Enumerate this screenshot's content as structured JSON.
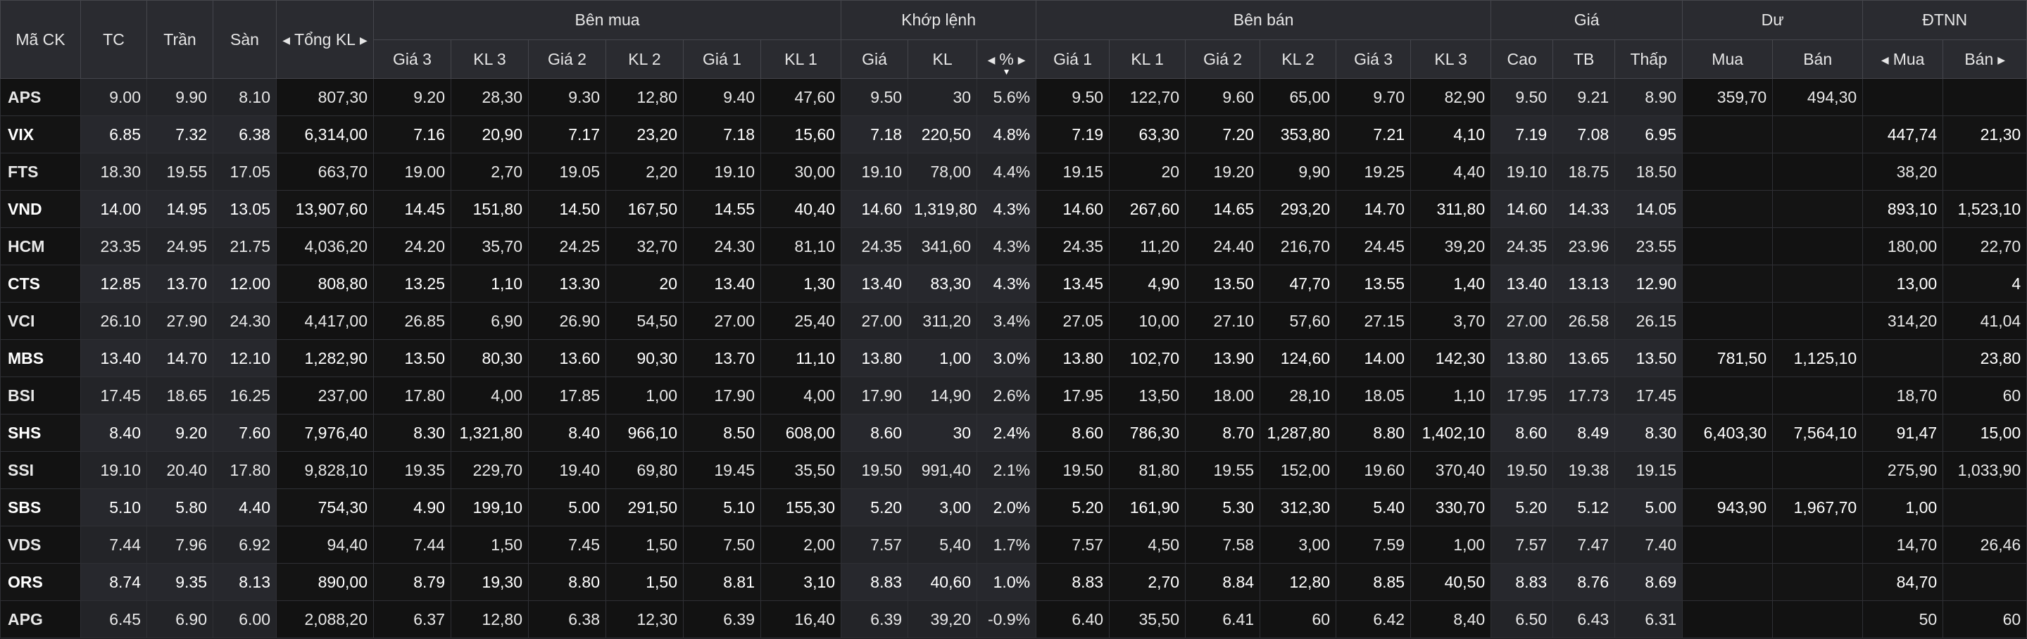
{
  "colors": {
    "up": "#2ee62e",
    "down": "#ff3b3b",
    "ref": "#f5c518",
    "ceiling": "#ff44ff",
    "floor": "#3cc8ff",
    "neutral": "#e8e8e8",
    "header_bg": "#2a2b30",
    "row_bg": "#121212"
  },
  "icons": {
    "scroll_left": "caret-left-icon",
    "scroll_right": "caret-right-icon",
    "sort_desc": "sort-desc-icon"
  },
  "header": {
    "symbol": "Mã CK",
    "ref": "TC",
    "ceiling": "Trần",
    "floor": "Sàn",
    "total_volume": "Tổng KL",
    "buy_group": "Bên mua",
    "match_group": "Khớp lệnh",
    "sell_group": "Bên bán",
    "price_group": "Giá",
    "residual_group": "Dư",
    "foreign_group": "ĐTNN",
    "buy_cols": [
      "Giá 3",
      "KL 3",
      "Giá 2",
      "KL 2",
      "Giá 1",
      "KL 1"
    ],
    "match_cols": [
      "Giá",
      "KL",
      "%"
    ],
    "sell_cols": [
      "Giá 1",
      "KL 1",
      "Giá 2",
      "KL 2",
      "Giá 3",
      "KL 3"
    ],
    "price_cols": [
      "Cao",
      "TB",
      "Thấp"
    ],
    "residual_cols": [
      "Mua",
      "Bán"
    ],
    "foreign_cols": [
      "Mua",
      "Bán"
    ]
  },
  "rows": [
    {
      "symbol": "APS",
      "ref": "9.00",
      "ceiling": "9.90",
      "floor": "8.10",
      "total": "807,30",
      "b3": "9.20",
      "bk3": "28,30",
      "b2": "9.30",
      "bk2": "12,80",
      "b1": "9.40",
      "bk1": "47,60",
      "mp": "9.50",
      "mk": "30",
      "pct": "5.6%",
      "s1": "9.50",
      "sk1": "122,70",
      "s2": "9.60",
      "sk2": "65,00",
      "s3": "9.70",
      "sk3": "82,90",
      "high": "9.50",
      "avg": "9.21",
      "low": "8.90",
      "rbuy": "359,70",
      "rsell": "494,30",
      "fbuy": "",
      "fsell": "",
      "c": {
        "symbol": "up",
        "b3": "up",
        "b2": "up",
        "b1": "up",
        "mp": "up",
        "s1": "up",
        "s2": "up",
        "s3": "up",
        "high": "up",
        "avg": "up",
        "low": "down"
      }
    },
    {
      "symbol": "VIX",
      "ref": "6.85",
      "ceiling": "7.32",
      "floor": "6.38",
      "total": "6,314,00",
      "b3": "7.16",
      "bk3": "20,90",
      "b2": "7.17",
      "bk2": "23,20",
      "b1": "7.18",
      "bk1": "15,60",
      "mp": "7.18",
      "mk": "220,50",
      "pct": "4.8%",
      "s1": "7.19",
      "sk1": "63,30",
      "s2": "7.20",
      "sk2": "353,80",
      "s3": "7.21",
      "sk3": "4,10",
      "high": "7.19",
      "avg": "7.08",
      "low": "6.95",
      "rbuy": "",
      "rsell": "",
      "fbuy": "447,74",
      "fsell": "21,30",
      "c": {
        "symbol": "up",
        "b3": "up",
        "b2": "up",
        "b1": "up",
        "mp": "up",
        "s1": "up",
        "s2": "up",
        "s3": "up",
        "high": "up",
        "avg": "up",
        "low": "up"
      }
    },
    {
      "symbol": "FTS",
      "ref": "18.30",
      "ceiling": "19.55",
      "floor": "17.05",
      "total": "663,70",
      "b3": "19.00",
      "bk3": "2,70",
      "b2": "19.05",
      "bk2": "2,20",
      "b1": "19.10",
      "bk1": "30,00",
      "mp": "19.10",
      "mk": "78,00",
      "pct": "4.4%",
      "s1": "19.15",
      "sk1": "20",
      "s2": "19.20",
      "sk2": "9,90",
      "s3": "19.25",
      "sk3": "4,40",
      "high": "19.10",
      "avg": "18.75",
      "low": "18.50",
      "rbuy": "",
      "rsell": "",
      "fbuy": "38,20",
      "fsell": "",
      "c": {
        "symbol": "up",
        "b3": "up",
        "b2": "up",
        "b1": "up",
        "mp": "up",
        "s1": "up",
        "s2": "up",
        "s3": "up",
        "high": "up",
        "avg": "up",
        "low": "up"
      }
    },
    {
      "symbol": "VND",
      "ref": "14.00",
      "ceiling": "14.95",
      "floor": "13.05",
      "total": "13,907,60",
      "b3": "14.45",
      "bk3": "151,80",
      "b2": "14.50",
      "bk2": "167,50",
      "b1": "14.55",
      "bk1": "40,40",
      "mp": "14.60",
      "mk": "1,319,80",
      "pct": "4.3%",
      "s1": "14.60",
      "sk1": "267,60",
      "s2": "14.65",
      "sk2": "293,20",
      "s3": "14.70",
      "sk3": "311,80",
      "high": "14.60",
      "avg": "14.33",
      "low": "14.05",
      "rbuy": "",
      "rsell": "",
      "fbuy": "893,10",
      "fsell": "1,523,10",
      "c": {
        "symbol": "up",
        "b3": "up",
        "b2": "up",
        "b1": "up",
        "mp": "up",
        "s1": "up",
        "s2": "up",
        "s3": "up",
        "high": "up",
        "avg": "up",
        "low": "up"
      }
    },
    {
      "symbol": "HCM",
      "ref": "23.35",
      "ceiling": "24.95",
      "floor": "21.75",
      "total": "4,036,20",
      "b3": "24.20",
      "bk3": "35,70",
      "b2": "24.25",
      "bk2": "32,70",
      "b1": "24.30",
      "bk1": "81,10",
      "mp": "24.35",
      "mk": "341,60",
      "pct": "4.3%",
      "s1": "24.35",
      "sk1": "11,20",
      "s2": "24.40",
      "sk2": "216,70",
      "s3": "24.45",
      "sk3": "39,20",
      "high": "24.35",
      "avg": "23.96",
      "low": "23.55",
      "rbuy": "",
      "rsell": "",
      "fbuy": "180,00",
      "fsell": "22,70",
      "c": {
        "symbol": "up",
        "b3": "up",
        "b2": "up",
        "b1": "up",
        "mp": "up",
        "s1": "up",
        "s2": "up",
        "s3": "up",
        "high": "up",
        "avg": "up",
        "low": "up"
      }
    },
    {
      "symbol": "CTS",
      "ref": "12.85",
      "ceiling": "13.70",
      "floor": "12.00",
      "total": "808,80",
      "b3": "13.25",
      "bk3": "1,10",
      "b2": "13.30",
      "bk2": "20",
      "b1": "13.40",
      "bk1": "1,30",
      "mp": "13.40",
      "mk": "83,30",
      "pct": "4.3%",
      "s1": "13.45",
      "sk1": "4,90",
      "s2": "13.50",
      "sk2": "47,70",
      "s3": "13.55",
      "sk3": "1,40",
      "high": "13.40",
      "avg": "13.13",
      "low": "12.90",
      "rbuy": "",
      "rsell": "",
      "fbuy": "13,00",
      "fsell": "4",
      "c": {
        "symbol": "up",
        "b3": "up",
        "b2": "up",
        "b1": "up",
        "mp": "up",
        "s1": "up",
        "s2": "up",
        "s3": "up",
        "high": "up",
        "avg": "up",
        "low": "up"
      }
    },
    {
      "symbol": "VCI",
      "ref": "26.10",
      "ceiling": "27.90",
      "floor": "24.30",
      "total": "4,417,00",
      "b3": "26.85",
      "bk3": "6,90",
      "b2": "26.90",
      "bk2": "54,50",
      "b1": "27.00",
      "bk1": "25,40",
      "mp": "27.00",
      "mk": "311,20",
      "pct": "3.4%",
      "s1": "27.05",
      "sk1": "10,00",
      "s2": "27.10",
      "sk2": "57,60",
      "s3": "27.15",
      "sk3": "3,70",
      "high": "27.00",
      "avg": "26.58",
      "low": "26.15",
      "rbuy": "",
      "rsell": "",
      "fbuy": "314,20",
      "fsell": "41,04",
      "c": {
        "symbol": "up",
        "b3": "up",
        "b2": "up",
        "b1": "up",
        "mp": "up",
        "s1": "up",
        "s2": "up",
        "s3": "up",
        "high": "up",
        "avg": "up",
        "low": "up"
      }
    },
    {
      "symbol": "MBS",
      "ref": "13.40",
      "ceiling": "14.70",
      "floor": "12.10",
      "total": "1,282,90",
      "b3": "13.50",
      "bk3": "80,30",
      "b2": "13.60",
      "bk2": "90,30",
      "b1": "13.70",
      "bk1": "11,10",
      "mp": "13.80",
      "mk": "1,00",
      "pct": "3.0%",
      "s1": "13.80",
      "sk1": "102,70",
      "s2": "13.90",
      "sk2": "124,60",
      "s3": "14.00",
      "sk3": "142,30",
      "high": "13.80",
      "avg": "13.65",
      "low": "13.50",
      "rbuy": "781,50",
      "rsell": "1,125,10",
      "fbuy": "",
      "fsell": "23,80",
      "c": {
        "symbol": "up",
        "b3": "up",
        "b2": "up",
        "b1": "up",
        "mp": "up",
        "s1": "up",
        "s2": "up",
        "s3": "up",
        "high": "up",
        "avg": "up",
        "low": "up"
      }
    },
    {
      "symbol": "BSI",
      "ref": "17.45",
      "ceiling": "18.65",
      "floor": "16.25",
      "total": "237,00",
      "b3": "17.80",
      "bk3": "4,00",
      "b2": "17.85",
      "bk2": "1,00",
      "b1": "17.90",
      "bk1": "4,00",
      "mp": "17.90",
      "mk": "14,90",
      "pct": "2.6%",
      "s1": "17.95",
      "sk1": "13,50",
      "s2": "18.00",
      "sk2": "28,10",
      "s3": "18.05",
      "sk3": "1,10",
      "high": "17.95",
      "avg": "17.73",
      "low": "17.45",
      "rbuy": "",
      "rsell": "",
      "fbuy": "18,70",
      "fsell": "60",
      "c": {
        "symbol": "up",
        "b3": "up",
        "b2": "up",
        "b1": "up",
        "mp": "up",
        "s1": "up",
        "s2": "up",
        "s3": "up",
        "high": "up",
        "avg": "up",
        "low": "ref"
      }
    },
    {
      "symbol": "SHS",
      "ref": "8.40",
      "ceiling": "9.20",
      "floor": "7.60",
      "total": "7,976,40",
      "b3": "8.30",
      "bk3": "1,321,80",
      "b2": "8.40",
      "bk2": "966,10",
      "b1": "8.50",
      "bk1": "608,00",
      "mp": "8.60",
      "mk": "30",
      "pct": "2.4%",
      "s1": "8.60",
      "sk1": "786,30",
      "s2": "8.70",
      "sk2": "1,287,80",
      "s3": "8.80",
      "sk3": "1,402,10",
      "high": "8.60",
      "avg": "8.49",
      "low": "8.30",
      "rbuy": "6,403,30",
      "rsell": "7,564,10",
      "fbuy": "91,47",
      "fsell": "15,00",
      "c": {
        "symbol": "up",
        "b3": "down",
        "b2": "ref",
        "b1": "up",
        "mp": "up",
        "s1": "up",
        "s2": "up",
        "s3": "up",
        "high": "up",
        "avg": "up",
        "low": "down"
      }
    },
    {
      "symbol": "SSI",
      "ref": "19.10",
      "ceiling": "20.40",
      "floor": "17.80",
      "total": "9,828,10",
      "b3": "19.35",
      "bk3": "229,70",
      "b2": "19.40",
      "bk2": "69,80",
      "b1": "19.45",
      "bk1": "35,50",
      "mp": "19.50",
      "mk": "991,40",
      "pct": "2.1%",
      "s1": "19.50",
      "sk1": "81,80",
      "s2": "19.55",
      "sk2": "152,00",
      "s3": "19.60",
      "sk3": "370,40",
      "high": "19.50",
      "avg": "19.38",
      "low": "19.15",
      "rbuy": "",
      "rsell": "",
      "fbuy": "275,90",
      "fsell": "1,033,90",
      "c": {
        "symbol": "up",
        "b3": "up",
        "b2": "up",
        "b1": "up",
        "mp": "up",
        "s1": "up",
        "s2": "up",
        "s3": "up",
        "high": "up",
        "avg": "up",
        "low": "up"
      }
    },
    {
      "symbol": "SBS",
      "ref": "5.10",
      "ceiling": "5.80",
      "floor": "4.40",
      "total": "754,30",
      "b3": "4.90",
      "bk3": "199,10",
      "b2": "5.00",
      "bk2": "291,50",
      "b1": "5.10",
      "bk1": "155,30",
      "mp": "5.20",
      "mk": "3,00",
      "pct": "2.0%",
      "s1": "5.20",
      "sk1": "161,90",
      "s2": "5.30",
      "sk2": "312,30",
      "s3": "5.40",
      "sk3": "330,70",
      "high": "5.20",
      "avg": "5.12",
      "low": "5.00",
      "rbuy": "943,90",
      "rsell": "1,967,70",
      "fbuy": "1,00",
      "fsell": "",
      "c": {
        "symbol": "up",
        "b3": "down",
        "b2": "down",
        "b1": "ref",
        "mp": "up",
        "s1": "up",
        "s2": "up",
        "s3": "up",
        "high": "up",
        "avg": "up",
        "low": "down"
      }
    },
    {
      "symbol": "VDS",
      "ref": "7.44",
      "ceiling": "7.96",
      "floor": "6.92",
      "total": "94,40",
      "b3": "7.44",
      "bk3": "1,50",
      "b2": "7.45",
      "bk2": "1,50",
      "b1": "7.50",
      "bk1": "2,00",
      "mp": "7.57",
      "mk": "5,40",
      "pct": "1.7%",
      "s1": "7.57",
      "sk1": "4,50",
      "s2": "7.58",
      "sk2": "3,00",
      "s3": "7.59",
      "sk3": "1,00",
      "high": "7.57",
      "avg": "7.47",
      "low": "7.40",
      "rbuy": "",
      "rsell": "",
      "fbuy": "14,70",
      "fsell": "26,46",
      "c": {
        "symbol": "up",
        "b3": "ref",
        "b2": "up",
        "b1": "up",
        "mp": "up",
        "s1": "up",
        "s2": "up",
        "s3": "up",
        "high": "up",
        "avg": "up",
        "low": "down"
      }
    },
    {
      "symbol": "ORS",
      "ref": "8.74",
      "ceiling": "9.35",
      "floor": "8.13",
      "total": "890,00",
      "b3": "8.79",
      "bk3": "19,30",
      "b2": "8.80",
      "bk2": "1,50",
      "b1": "8.81",
      "bk1": "3,10",
      "mp": "8.83",
      "mk": "40,60",
      "pct": "1.0%",
      "s1": "8.83",
      "sk1": "2,70",
      "s2": "8.84",
      "sk2": "12,80",
      "s3": "8.85",
      "sk3": "40,50",
      "high": "8.83",
      "avg": "8.76",
      "low": "8.69",
      "rbuy": "",
      "rsell": "",
      "fbuy": "84,70",
      "fsell": "",
      "c": {
        "symbol": "up",
        "b3": "up",
        "b2": "up",
        "b1": "up",
        "mp": "up",
        "s1": "up",
        "s2": "up",
        "s3": "up",
        "high": "up",
        "avg": "up",
        "low": "down"
      }
    },
    {
      "symbol": "APG",
      "ref": "6.45",
      "ceiling": "6.90",
      "floor": "6.00",
      "total": "2,088,20",
      "b3": "6.37",
      "bk3": "12,80",
      "b2": "6.38",
      "bk2": "12,30",
      "b1": "6.39",
      "bk1": "16,40",
      "mp": "6.39",
      "mk": "39,20",
      "pct": "-0.9%",
      "s1": "6.40",
      "sk1": "35,50",
      "s2": "6.41",
      "sk2": "60",
      "s3": "6.42",
      "sk3": "8,40",
      "high": "6.50",
      "avg": "6.43",
      "low": "6.31",
      "rbuy": "",
      "rsell": "",
      "fbuy": "50",
      "fsell": "60",
      "c": {
        "symbol": "down",
        "b3": "down",
        "b2": "down",
        "b1": "down",
        "mp": "down",
        "s1": "down",
        "s2": "down",
        "s3": "down",
        "high": "up",
        "avg": "down",
        "low": "down"
      }
    }
  ]
}
